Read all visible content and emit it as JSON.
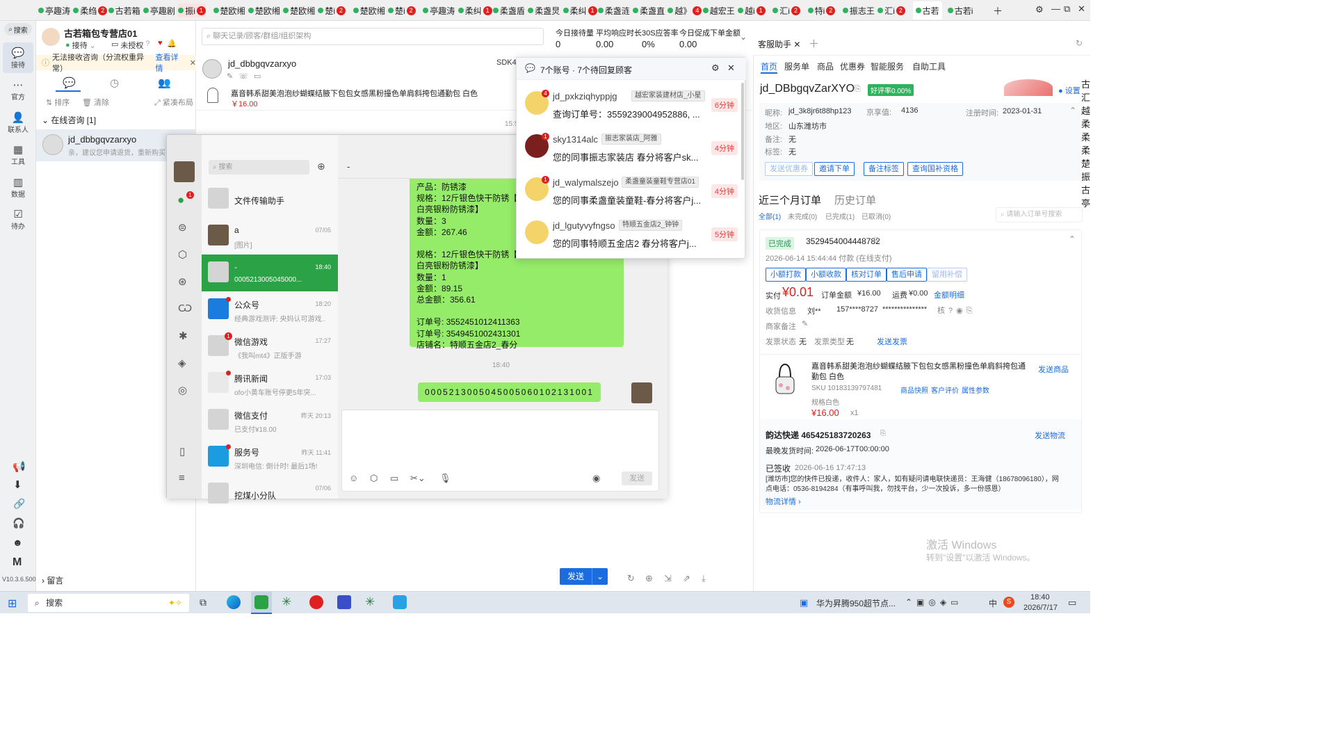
{
  "tabs": [
    {
      "label": "亭趣涛",
      "badge": ""
    },
    {
      "label": "柔绉",
      "badge": "2"
    },
    {
      "label": "古若箱",
      "badge": ""
    },
    {
      "label": "亭趣剧",
      "badge": ""
    },
    {
      "label": "振i",
      "badge": "1"
    },
    {
      "label": "楚欧缃",
      "badge": ""
    },
    {
      "label": "楚欧缃",
      "badge": ""
    },
    {
      "label": "楚欧缃",
      "badge": ""
    },
    {
      "label": "楚i",
      "badge": "2"
    },
    {
      "label": "楚欧缃",
      "badge": ""
    },
    {
      "label": "楚i",
      "badge": "2"
    },
    {
      "label": "亭趣涛",
      "badge": ""
    },
    {
      "label": "柔纠",
      "badge": "1"
    },
    {
      "label": "柔盏盾",
      "badge": ""
    },
    {
      "label": "柔盏炅",
      "badge": ""
    },
    {
      "label": "柔纠",
      "badge": "1"
    },
    {
      "label": "柔盏涟",
      "badge": ""
    },
    {
      "label": "柔盏直",
      "badge": ""
    },
    {
      "label": "越》",
      "badge": "4"
    },
    {
      "label": "越宏王",
      "badge": ""
    },
    {
      "label": "越i",
      "badge": "1"
    },
    {
      "label": "汇i",
      "badge": "2"
    },
    {
      "label": "特i",
      "badge": "2"
    },
    {
      "label": "振志王",
      "badge": ""
    },
    {
      "label": "汇i",
      "badge": "2"
    },
    {
      "label": "古若",
      "badge": "",
      "active": true
    },
    {
      "label": "古若i",
      "badge": ""
    }
  ],
  "leftnav": {
    "search": "搜索",
    "items": [
      {
        "label": "接待",
        "icon": "chat-icon"
      },
      {
        "label": "官方",
        "icon": "message-icon"
      },
      {
        "label": "联系人",
        "icon": "contacts-icon"
      },
      {
        "label": "工具",
        "icon": "grid-icon"
      },
      {
        "label": "数据",
        "icon": "chart-icon"
      },
      {
        "label": "待办",
        "icon": "todo-icon"
      }
    ],
    "bottom_icon": "M",
    "version": "V10.3.6.500"
  },
  "store": {
    "name": "古若箱包专营店01",
    "status": "接待",
    "auth": "未授权"
  },
  "alert": {
    "text": "无法接收咨询（分流权重异常）",
    "link": "查看详情"
  },
  "col2": {
    "tools": [
      {
        "label": "排序"
      },
      {
        "label": "清除"
      },
      {
        "label": "紧凑布局"
      }
    ],
    "section": "在线咨询 [1]",
    "session": {
      "name": "jd_dbbgqvzarxyo",
      "preview": "亲，建议您申请退货，重新购买"
    },
    "footer": "留言"
  },
  "topsearch": {
    "placeholder": "聊天记录/顾客/群组/组织架构"
  },
  "stats": [
    {
      "label": "今日接待量",
      "value": "0"
    },
    {
      "label": "平均响应时长",
      "value": "0.00"
    },
    {
      "label": "30S应答率",
      "value": "0%"
    },
    {
      "label": "今日促成下单金额",
      "value": "0.00"
    }
  ],
  "chat": {
    "customer": "jd_dbbgqvzarxyo",
    "sdk": "SDK4",
    "product_title": "嘉音韩系甜美泡泡纱蝴蝶结腋下包包女感黑粉撞色单肩斜挎包通勤包 白色",
    "product_price": "￥16.00",
    "time_label": "15:5",
    "send": "发送"
  },
  "popup": {
    "title": "7个账号 · 7个待回复顾客",
    "items": [
      {
        "name": "jd_pxkziqhyppjg",
        "tag": "越宏家装建材店_小星",
        "msg": "查询订单号：3559239004952886, ...",
        "time": "6分钟",
        "badge": "4"
      },
      {
        "name": "sky1314alc",
        "tag": "振志家装店_阿雅",
        "msg": "您的同事振志家装店 春分将客户sk...",
        "time": "4分钟",
        "badge": "1"
      },
      {
        "name": "jd_walymalszejo",
        "tag": "柔盏童装童鞋专营店01",
        "msg": "您的同事柔盏童装童鞋-春分将客户j...",
        "time": "4分钟",
        "badge": "1"
      },
      {
        "name": "jd_lgutyvyfngso",
        "tag": "特顺五金店2_钟钟",
        "msg": "您的同事特顺五金店2 春分将客户j...",
        "time": "5分钟",
        "badge": ""
      }
    ]
  },
  "wechat": {
    "search": "搜索",
    "title": "-",
    "list": [
      {
        "name": "文件传输助手",
        "time": "",
        "preview": ""
      },
      {
        "name": "a",
        "time": "07/05",
        "preview": "[图片]"
      },
      {
        "name": "-",
        "time": "18:40",
        "preview": "0005213005045000..."
      },
      {
        "name": "公众号",
        "time": "18:20",
        "preview": "经典游戏测评: 央妈认可游戏..."
      },
      {
        "name": "微信游戏",
        "time": "17:27",
        "preview": "《我叫mt4》正版手游"
      },
      {
        "name": "腾讯新闻",
        "time": "17:03",
        "preview": "ofo小黄车账号停更5年突..."
      },
      {
        "name": "微信支付",
        "time": "昨天 20:13",
        "preview": "已支付¥18.00"
      },
      {
        "name": "服务号",
        "time": "昨天 11:41",
        "preview": "深圳电信: 倒计时! 最后1场!"
      },
      {
        "name": "挖煤小分队",
        "time": "07/06",
        "preview": ""
      }
    ],
    "bubble_lines": [
      "产品：防锈漆",
      "规格：12斤银色快干防锈【送",
      "白亮银粉防锈漆】",
      "数量：3",
      "金额：267.46",
      "",
      "规格：12斤银色快干防锈【送",
      "白亮银粉防锈漆】",
      "数量：1",
      "金额：89.15",
      "总金额：356.61",
      "",
      "订单号: 3552451012411363",
      "订单号: 3549451002431301",
      "店铺名：特顺五金店2_春分"
    ],
    "time_sep": "18:40",
    "sent": "0005213005045005060102131001",
    "send_btn": "发送"
  },
  "right": {
    "tab": "客服助手",
    "nav": [
      "首页",
      "服务单",
      "商品",
      "优惠券",
      "智能服务",
      "自助工具"
    ],
    "customer": "jd_DBbgqvZarXYO",
    "rate": "好评率0.00%",
    "settings": "设置",
    "nick_label": "昵称:",
    "nick": "jd_3k8jr6t88hp123",
    "jx_label": "京享值:",
    "jx": "4136",
    "reg_label": "注册时间:",
    "reg": "2023-01-31",
    "area_label": "地区:",
    "area": "山东潍坊市",
    "note_label": "备注:",
    "note": "无",
    "tag_label": "标签:",
    "tag": "无",
    "actions": [
      "发送优惠券",
      "邀请下单",
      "备注标签",
      "查询国补资格"
    ],
    "order_tabs": [
      "近三个月订单",
      "历史订单"
    ],
    "filters": [
      "全部(1)",
      "未完成(0)",
      "已完成(1)",
      "已取消(0)"
    ],
    "order_search": "请输入订单号搜索",
    "order": {
      "status": "已完成",
      "id": "3529454004448782",
      "paytime": "2026-06-14 15:44:44 付款 (在线支付)",
      "buttons": [
        "小额打款",
        "小额收款",
        "核对订单",
        "售后申请",
        "留用补偿"
      ],
      "paid_label": "实付",
      "paid": "¥0.01",
      "amount_label": "订单金额",
      "amount": "¥16.00",
      "freight_label": "运费",
      "freight": "¥0.00",
      "detail": "金额明细",
      "recv_label": "收货信息",
      "recv_name": "刘**",
      "recv_phone": "157****8727",
      "recv_addr": "***************",
      "merchant_note": "商家备注",
      "invoice_status_label": "发票状态",
      "invoice_status": "无",
      "invoice_type_label": "发票类型",
      "invoice_type": "无",
      "invoice_send": "发送发票",
      "product": {
        "title": "嘉音韩系甜美泡泡纱蝴蝶结腋下包包女感黑粉撞色单肩斜挎包通勤包 白色",
        "sku": "SKU 10183139797481",
        "links": [
          "商品快照",
          "客户评价",
          "属性参数"
        ],
        "spec": "规格白色",
        "price": "¥16.00",
        "qty": "x1",
        "send": "发送商品"
      },
      "express": {
        "name": "韵达快递 465425183720263",
        "send": "发送物流",
        "latest_label": "最晚发货时间:",
        "latest": "2026-06-17T00:00:00",
        "signed": "已签收",
        "signed_time": "2026-06-16 17:47:13",
        "detail": "[潍坊市]您的快件已投递，收件人：家人，如有疑问请电联快递员：王海健（18678096180），网点电话：0536-8194284（有事呼叫我，勿找平台，少一次投诉，多一份感恩）",
        "more": "物流详情"
      }
    },
    "activate_title": "激活 Windows",
    "activate_sub": "转到\"设置\"以激活 Windows。"
  },
  "taskbar": {
    "search": "搜索",
    "notice": "华为昇腾950超节点...",
    "ime": "中",
    "time": "18:40",
    "date": "2026/7/17"
  }
}
